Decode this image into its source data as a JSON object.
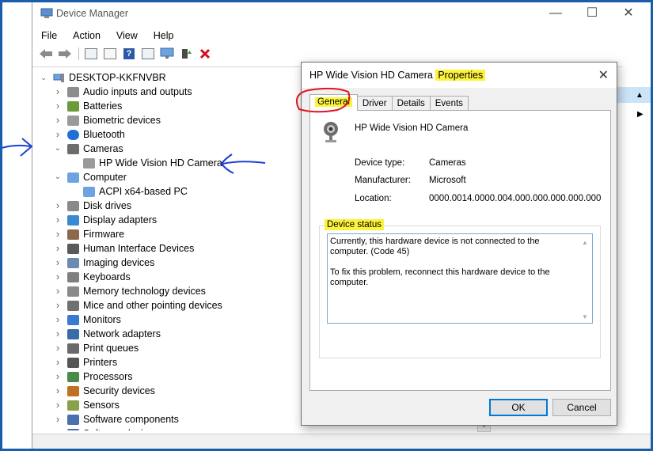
{
  "window": {
    "title": "Device Manager",
    "minimize": "—",
    "maximize": "☐",
    "close": "✕"
  },
  "menu": [
    "File",
    "Action",
    "View",
    "Help"
  ],
  "tree": {
    "root": "DESKTOP-KKFNVBR",
    "items": [
      "Audio inputs and outputs",
      "Batteries",
      "Biometric devices",
      "Bluetooth",
      "Cameras",
      "HP Wide Vision HD Camera",
      "Computer",
      "ACPI x64-based PC",
      "Disk drives",
      "Display adapters",
      "Firmware",
      "Human Interface Devices",
      "Imaging devices",
      "Keyboards",
      "Memory technology devices",
      "Mice and other pointing devices",
      "Monitors",
      "Network adapters",
      "Print queues",
      "Printers",
      "Processors",
      "Security devices",
      "Sensors",
      "Software components",
      "Software devices"
    ]
  },
  "dialog": {
    "title_prefix": "HP Wide Vision HD Camera",
    "title_highlight": "Properties",
    "close": "✕",
    "tabs": [
      "General",
      "Driver",
      "Details",
      "Events"
    ],
    "device_name": "HP Wide Vision HD Camera",
    "props": [
      {
        "label": "Device type:",
        "value": "Cameras"
      },
      {
        "label": "Manufacturer:",
        "value": "Microsoft"
      },
      {
        "label": "Location:",
        "value": "0000.0014.0000.004.000.000.000.000.000"
      }
    ],
    "status_group": "Device status",
    "status_line1": "Currently, this hardware device is not connected to the computer. (Code 45)",
    "status_line2": "To fix this problem, reconnect this hardware device to the computer.",
    "ok": "OK",
    "cancel": "Cancel"
  },
  "colors": {
    "highlight": "#fbf33c",
    "annotation_blue": "#1a3fd6",
    "annotation_red": "#e0141e",
    "frame": "#1a5dab"
  }
}
